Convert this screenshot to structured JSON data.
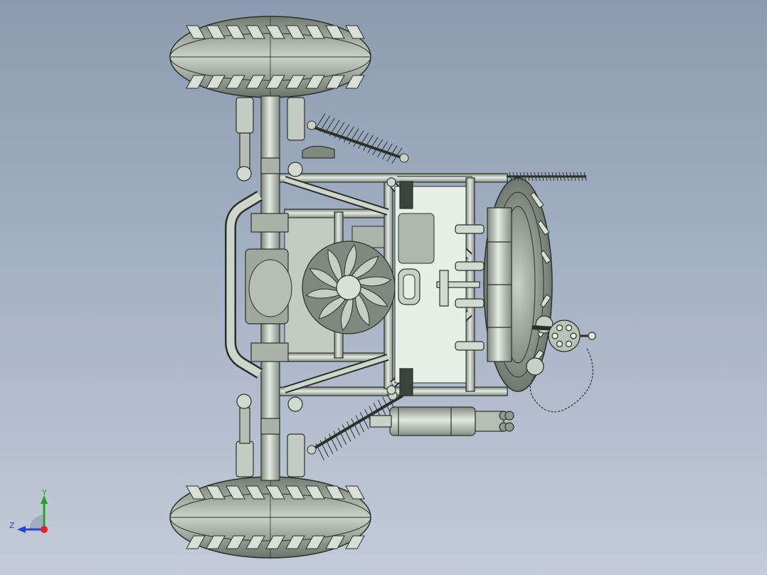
{
  "viewport": {
    "background_top": "#8c9bb1",
    "background_bottom": "#c4cbd8",
    "model": "chassis-top-view"
  },
  "colors": {
    "steel": "#b9c4b9",
    "tire": "#8d978d",
    "tread": "#d7dfd6",
    "edge": "#2a302a",
    "panel": "#e6f0e6"
  },
  "triad": {
    "y_label": "Y",
    "z_label": "Z",
    "y_color": "#26a426",
    "z_color": "#2c46d0",
    "x_color": "#e0222a"
  }
}
